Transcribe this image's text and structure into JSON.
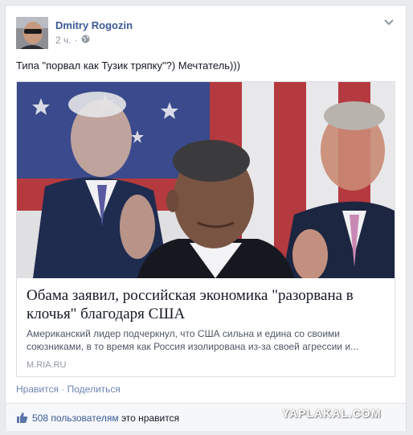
{
  "post": {
    "author": "Dmitry Rogozin",
    "time": "2 ч.",
    "dot": "·",
    "text": "Типа \"порвал как Тузик тряпку\"?) Мечтатель)))"
  },
  "link_card": {
    "title": "Обама заявил, российская экономика \"разорвана в клочья\" благодаря США",
    "description": "Американский лидер подчеркнул, что США сильна и едина со своими союзниками, в то время как Россия изолирована из-за своей агрессии и...",
    "domain": "M.RIA.RU"
  },
  "actions": {
    "like": "Нравится",
    "separator": " · ",
    "share": "Поделиться"
  },
  "likes": {
    "count_text": "508 пользователям",
    "suffix": " это нравится"
  },
  "watermark": "YAPLAKAL.COM",
  "colors": {
    "link_blue": "#3b5998",
    "muted": "#9197a3",
    "background": "#e9ebee"
  },
  "icons": [
    "globe-icon",
    "chevron-down-icon",
    "thumbs-up-icon"
  ]
}
